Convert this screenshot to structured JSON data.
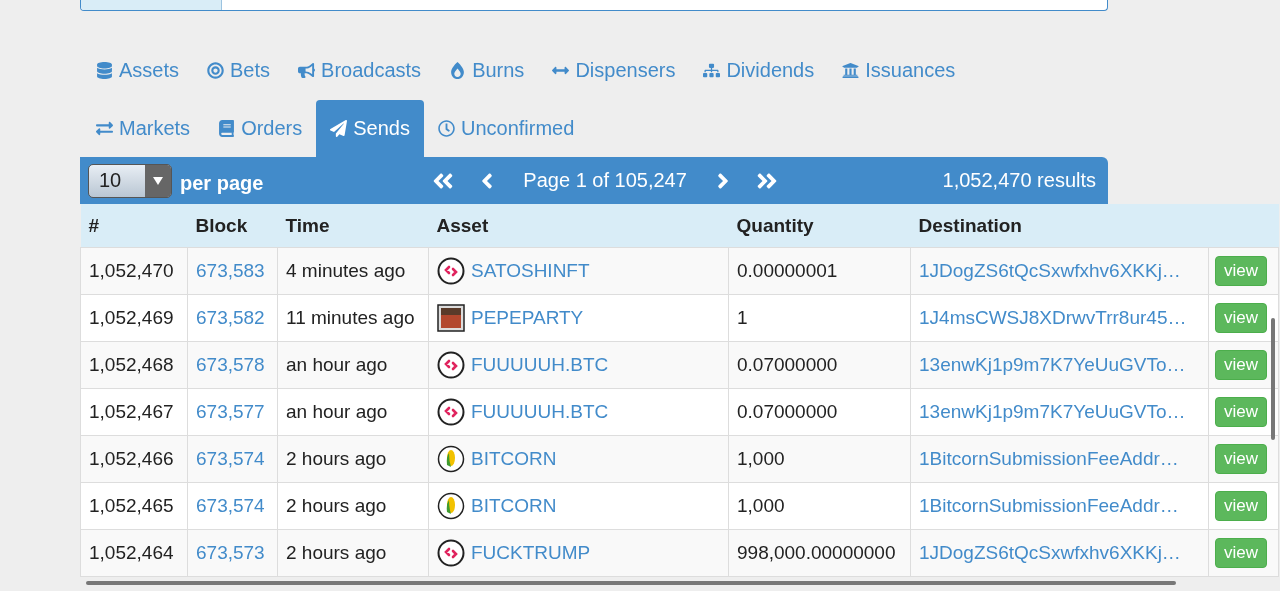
{
  "tab_rows": [
    [
      {
        "label": "Assets",
        "selected": false
      },
      {
        "label": "Bets",
        "selected": false
      },
      {
        "label": "Broadcasts",
        "selected": false
      },
      {
        "label": "Burns",
        "selected": false
      },
      {
        "label": "Dispensers",
        "selected": false
      },
      {
        "label": "Dividends",
        "selected": false
      },
      {
        "label": "Issuances",
        "selected": false
      }
    ],
    [
      {
        "label": "Markets",
        "selected": false
      },
      {
        "label": "Orders",
        "selected": false
      },
      {
        "label": "Sends",
        "selected": true
      },
      {
        "label": "Unconfirmed",
        "selected": false
      }
    ]
  ],
  "pager": {
    "per_page": "10",
    "per_page_label": "per page",
    "page": "Page 1 of 105,247",
    "results": "1,052,470 results"
  },
  "table": {
    "columns": [
      "#",
      "Block",
      "Time",
      "Asset",
      "Quantity",
      "Destination"
    ],
    "rows": [
      {
        "index": "1,052,470",
        "block": "673,583",
        "time": "4 minutes ago",
        "asset": {
          "name": "SATOSHINFT",
          "kind": "logo"
        },
        "quantity": "0.00000001",
        "destination": "1JDogZS6tQcSxwfxhv6XKKj…",
        "action": "view"
      },
      {
        "index": "1,052,469",
        "block": "673,582",
        "time": "11 minutes ago",
        "asset": {
          "name": "PEPEPARTY",
          "kind": "image"
        },
        "quantity": "1",
        "destination": "1J4msCWSJ8XDrwvTrr8ur45…",
        "action": "view"
      },
      {
        "index": "1,052,468",
        "block": "673,578",
        "time": "an hour ago",
        "asset": {
          "name": "FUUUUUH.BTC",
          "kind": "logo"
        },
        "quantity": "0.07000000",
        "destination": "13enwKj1p9m7K7YeUuGVTo…",
        "action": "view"
      },
      {
        "index": "1,052,467",
        "block": "673,577",
        "time": "an hour ago",
        "asset": {
          "name": "FUUUUUH.BTC",
          "kind": "logo"
        },
        "quantity": "0.07000000",
        "destination": "13enwKj1p9m7K7YeUuGVTo…",
        "action": "view"
      },
      {
        "index": "1,052,466",
        "block": "673,574",
        "time": "2 hours ago",
        "asset": {
          "name": "BITCORN",
          "kind": "corn"
        },
        "quantity": "1,000",
        "destination": "1BitcornSubmissionFeeAddr…",
        "action": "view"
      },
      {
        "index": "1,052,465",
        "block": "673,574",
        "time": "2 hours ago",
        "asset": {
          "name": "BITCORN",
          "kind": "corn"
        },
        "quantity": "1,000",
        "destination": "1BitcornSubmissionFeeAddr…",
        "action": "view"
      },
      {
        "index": "1,052,464",
        "block": "673,573",
        "time": "2 hours ago",
        "asset": {
          "name": "FUCKTRUMP",
          "kind": "logo"
        },
        "quantity": "998,000.00000000",
        "destination": "1JDogZS6tQcSxwfxhv6XKKj…",
        "action": "view"
      }
    ]
  }
}
